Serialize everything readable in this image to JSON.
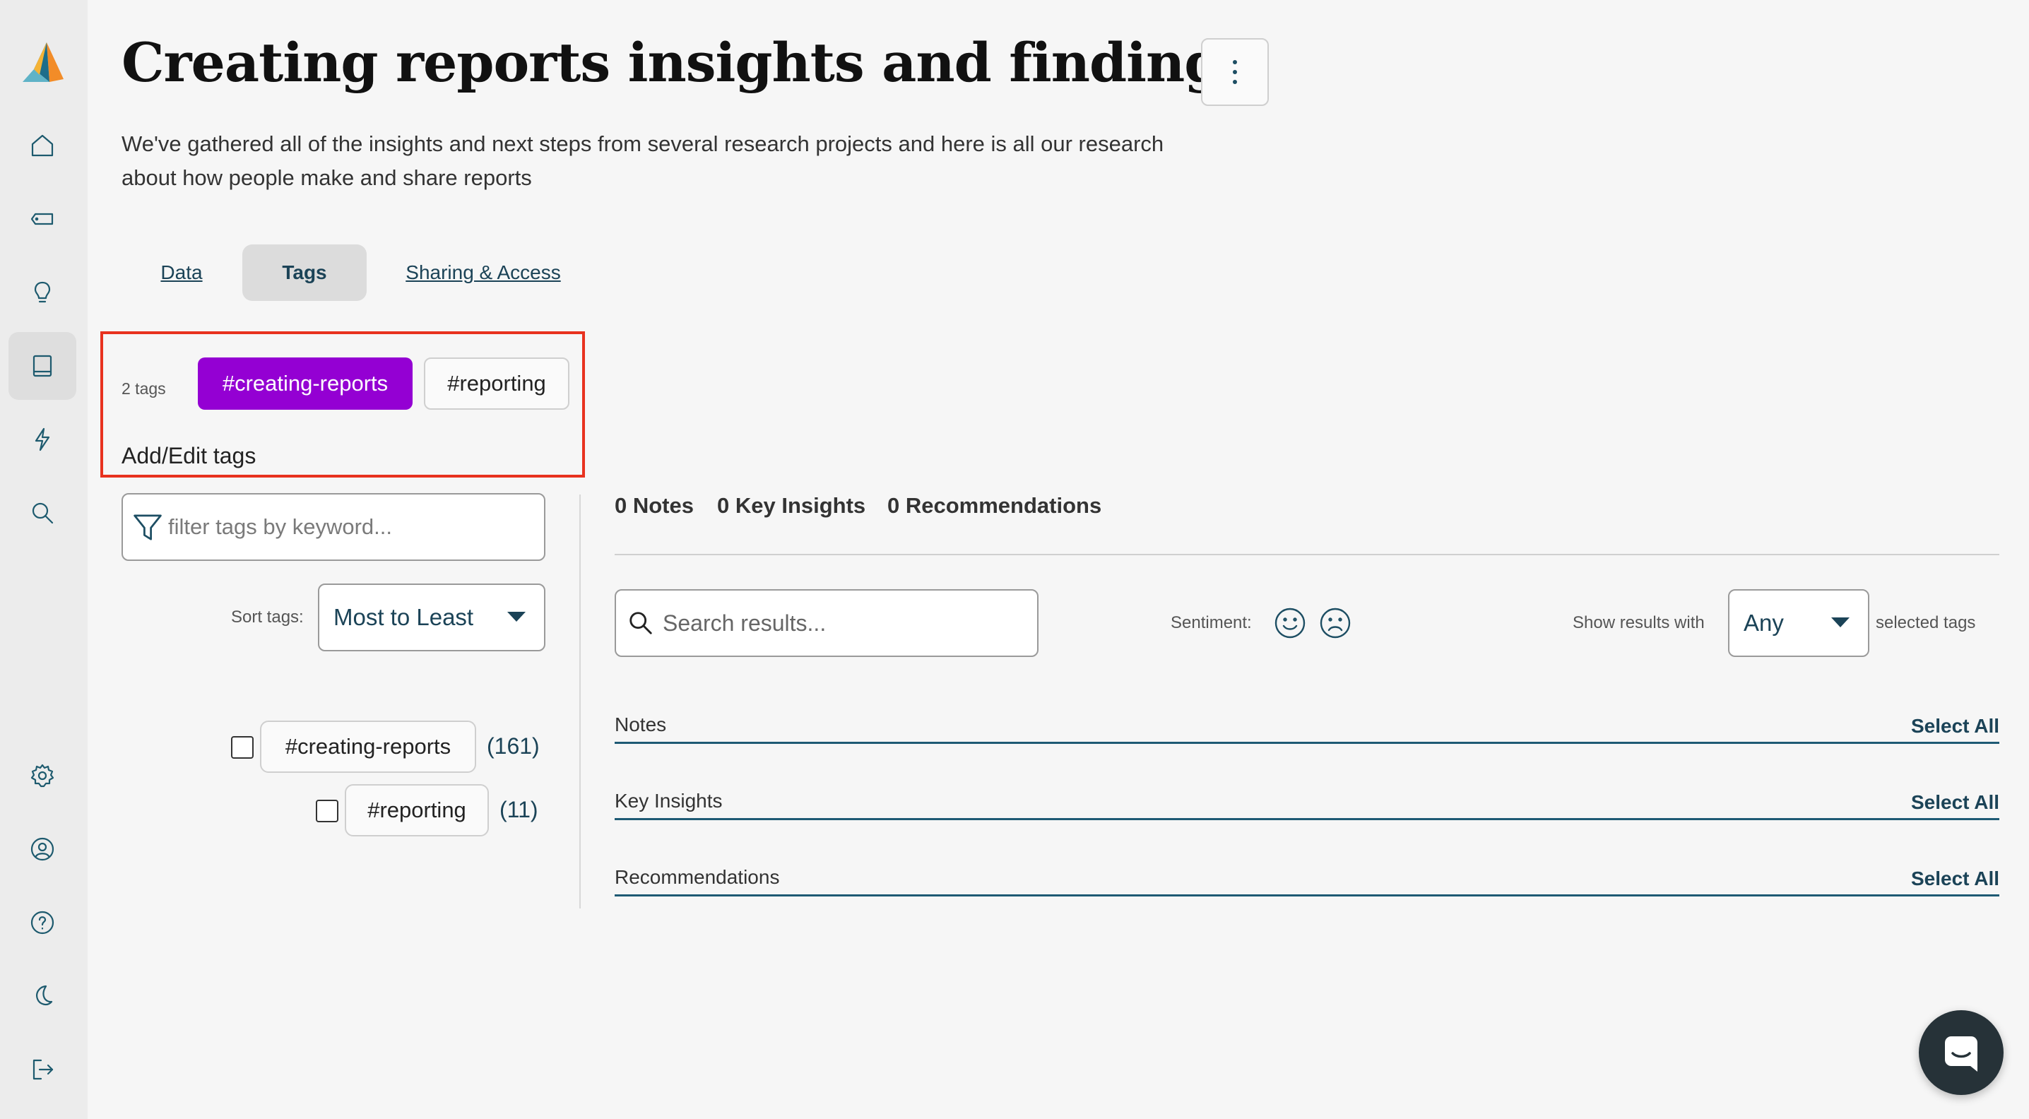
{
  "project": {
    "title": "Creating reports insights and findings",
    "description": "We've gathered all of the insights and next steps from several research projects and here is all our research about how people make and share reports"
  },
  "sidebar": {
    "items": [
      {
        "name": "home-icon"
      },
      {
        "name": "tag-icon"
      },
      {
        "name": "lightbulb-icon"
      },
      {
        "name": "book-icon",
        "active": true
      },
      {
        "name": "lightning-icon"
      },
      {
        "name": "search-icon"
      },
      {
        "name": "gear-icon"
      },
      {
        "name": "user-circle-icon"
      },
      {
        "name": "help-icon"
      },
      {
        "name": "moon-icon"
      },
      {
        "name": "logout-icon"
      }
    ]
  },
  "tabs": [
    {
      "label": "Data",
      "active": false
    },
    {
      "label": "Tags",
      "active": true
    },
    {
      "label": "Sharing & Access",
      "active": false
    }
  ],
  "applied_tags": {
    "count_label": "2 tags",
    "tags": [
      "#creating-reports",
      "#reporting"
    ],
    "add_edit_label": "Add/Edit tags"
  },
  "tag_filter": {
    "placeholder": "filter tags by keyword...",
    "sort_label": "Sort tags:",
    "sort_value": "Most to Least",
    "tags": [
      {
        "label": "#creating-reports",
        "count": "(161)",
        "checked": false
      },
      {
        "label": "#reporting",
        "count": "(11)",
        "checked": false
      }
    ]
  },
  "results": {
    "stats": [
      "0 Notes",
      "0 Key Insights",
      "0 Recommendations"
    ],
    "search_placeholder": "Search results...",
    "sentiment_label": "Sentiment:",
    "sentiment_icons": [
      "smile-icon",
      "frown-icon"
    ],
    "show_results_label": "Show results with",
    "match_value": "Any",
    "selected_tags_label": "selected tags",
    "sections": [
      {
        "label": "Notes",
        "action": "Select All"
      },
      {
        "label": "Key Insights",
        "action": "Select All"
      },
      {
        "label": "Recommendations",
        "action": "Select All"
      }
    ]
  },
  "colors": {
    "accent": "#1d4e63",
    "tag_active": "#9400d3",
    "highlight_box": "#e8321f"
  },
  "chat": {
    "icon": "chat-icon"
  }
}
